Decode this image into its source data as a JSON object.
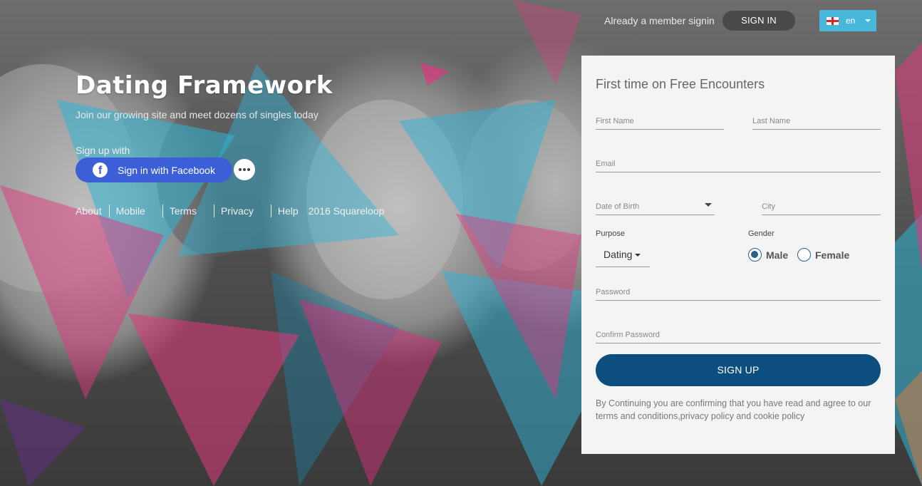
{
  "header": {
    "member_text": "Already a member signin",
    "signin_label": "SIGN IN",
    "language": "en"
  },
  "hero": {
    "logo": "Dating Framework",
    "tagline": "Join our growing site and meet dozens of singles today",
    "signup_with": "Sign up with",
    "facebook_label": "Sign in with Facebook"
  },
  "footer": {
    "links": [
      "About",
      "Mobile",
      "Terms",
      "Privacy",
      "Help"
    ],
    "copyright": "2016 Squareloop"
  },
  "form": {
    "title": "First time on Free Encounters",
    "first_name": "First Name",
    "last_name": "Last Name",
    "email": "Email",
    "dob": "Date of Birth",
    "city": "City",
    "purpose_label": "Purpose",
    "purpose_value": "Dating",
    "gender_label": "Gender",
    "gender_options": [
      "Male",
      "Female"
    ],
    "gender_selected": "Male",
    "password": "Password",
    "confirm_password": "Confirm Password",
    "signup_label": "SIGN UP",
    "terms": "By Continuing you are confirming that you have read and agree to our terms and conditions,privacy policy and cookie policy"
  },
  "colors": {
    "accent_blue": "#47b8d9",
    "facebook_blue": "#3c5ed6",
    "signup_navy": "#0c4e7e",
    "overlay_pink": "#e0387e",
    "overlay_cyan": "#2fb4d6"
  }
}
